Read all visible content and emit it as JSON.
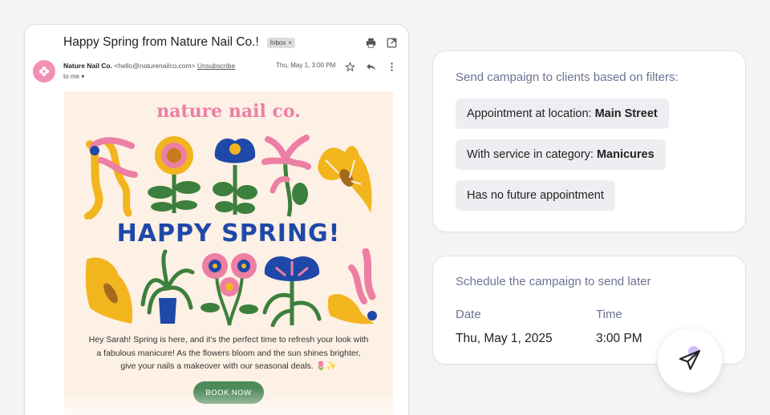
{
  "email": {
    "subject": "Happy Spring from Nature Nail Co.!",
    "inbox_tag": "Inbox",
    "inbox_tag_close": "×",
    "sender_name": "Nature Nail Co.",
    "sender_email": "<hello@naturenailco.com>",
    "unsubscribe": "Unsubscribe",
    "to": "to me",
    "date": "Thu, May 1, 3:00 PM",
    "icons": [
      "print-icon",
      "open-in-new-icon",
      "star-icon",
      "reply-icon",
      "more-icon"
    ]
  },
  "newsletter": {
    "brand": "nature nail co.",
    "headline": "HAPPY SPRING!",
    "body": "Hey Sarah! Spring is here, and it's the perfect time to refresh your look with a fabulous manicure! As the flowers bloom and the sun shines brighter, give your nails a makeover with our seasonal deals. 🌷✨",
    "cta": "BOOK NOW",
    "colors": {
      "pink": "#ec7fa3",
      "blue": "#1f49a8",
      "yellow": "#f2b51e",
      "green": "#3d7f3c",
      "cream": "#fdf0e4"
    }
  },
  "filters": {
    "title": "Send campaign to clients based on filters:",
    "chips": [
      {
        "prefix": "Appointment at location:",
        "value": "Main Street"
      },
      {
        "prefix": "With service in category:",
        "value": "Manicures"
      },
      {
        "prefix": "Has no future appointment",
        "value": ""
      }
    ]
  },
  "schedule": {
    "title": "Schedule the campaign to send later",
    "date_label": "Date",
    "date_value": "Thu, May 1, 2025",
    "time_label": "Time",
    "time_value": "3:00 PM"
  },
  "send_button": {
    "icon": "send-icon"
  }
}
